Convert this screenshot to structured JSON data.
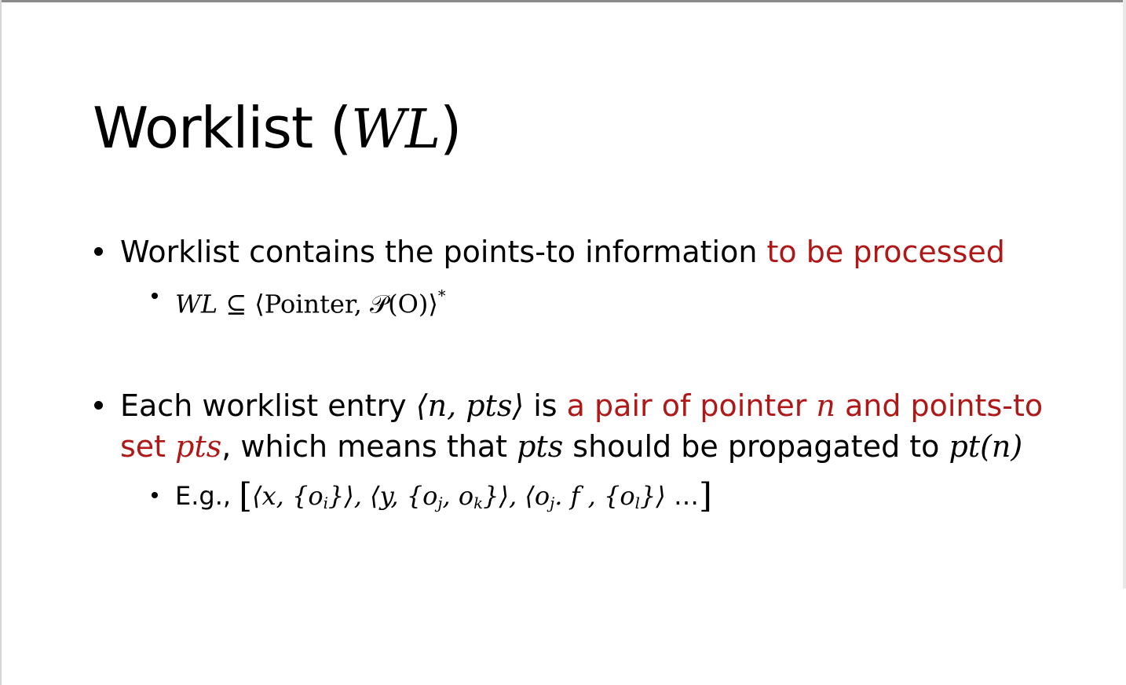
{
  "slide": {
    "title_text": "Worklist (",
    "title_math": "WL",
    "title_close": ")"
  },
  "bullet1": {
    "text_plain": "Worklist contains the points-to information ",
    "text_red": "to be processed",
    "sub": {
      "formula_lhs": "WL",
      "formula_subset": " ⊆ ",
      "formula_rhs": "⟨Pointer, 𝒫(O)⟩",
      "formula_star": "*"
    }
  },
  "bullet2": {
    "part1": "Each worklist entry ",
    "entry": "⟨n, pts⟩",
    "part2": " is ",
    "red1": "a pair of pointer ",
    "n1": "n",
    "red2": " and points-to",
    "red3": "set ",
    "pts1": "pts",
    "part3": ", which means that ",
    "pts2": "pts",
    "part4": " should be propagated to ",
    "pt_n": "pt(n)",
    "sub": {
      "eg_label": "E.g., ",
      "open_bracket": "[",
      "item1_open": "⟨x, {o",
      "item1_sub": "i",
      "item1_close": "}⟩, ",
      "item2_open": "⟨y, {o",
      "item2_sub_a": "j",
      "item2_mid": ", o",
      "item2_sub_b": "k",
      "item2_close": "}⟩, ",
      "item3_open": "⟨o",
      "item3_sub_a": "j",
      "item3_mid": ". f , {o",
      "item3_sub_b": "l",
      "item3_close": "}⟩ ",
      "ellipsis": "…",
      "close_bracket": "]"
    }
  }
}
